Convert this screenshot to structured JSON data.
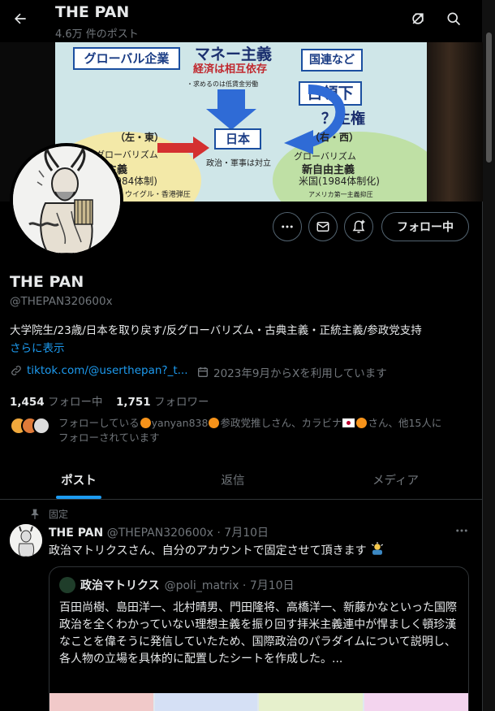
{
  "header": {
    "name": "THE PAN",
    "post_count": "4.6万 件のポスト"
  },
  "banner": {
    "global_corp": "グローバル企業",
    "money": "マネー主義",
    "money_sub": "経済は相互依存",
    "un": "国連など",
    "occupied": "占領下",
    "sovereignty": "？主権",
    "left_east": "（左・東）",
    "right_west": "（右・西）",
    "japan": "日本",
    "japan_sub": "政治・軍事は対立",
    "gp_left": "グローバリズム",
    "gp_left2": "産主義",
    "gp_left3": "共(1984体制)",
    "gp_left4": "ベット・ウイグル・香港弾圧",
    "gp_right": "グローバリズム",
    "gp_right2": "新自由主義",
    "gp_right3": "米国(1984体制化)",
    "gp_right4": "アメリカ第一主義抑圧",
    "low_wage": "・求めるのは低賃金労働"
  },
  "actions": {
    "follow_label": "フォロー中"
  },
  "profile": {
    "name": "THE PAN",
    "handle": "@THEPAN320600x",
    "bio": "大学院生/23歳/日本を取り戻す/反グローバリズム・古典主義・正統主義/参政党支持",
    "show_more": "さらに表示",
    "link": "tiktok.com/@userthepan?_t...",
    "joined": "2023年9月からXを利用しています",
    "following_count": "1,454",
    "following_label": "フォロー中",
    "followers_count": "1,751",
    "followers_label": "フォロワー",
    "followed_by_1": "フォローしている",
    "followed_by_2": "yanyan838",
    "followed_by_3": "参政党推しさん、カラビナ",
    "followed_by_4": "さん、他15人に",
    "followed_by_5": "フォローされています"
  },
  "tabs": [
    "ポスト",
    "返信",
    "メディア"
  ],
  "tweet": {
    "pinned_label": "固定",
    "author": "THE PAN",
    "handle_date": "@THEPAN320600x · 7月10日",
    "text": "政治マトリクスさん、自分のアカウントで固定させて頂きます",
    "quote": {
      "author": "政治マトリクス",
      "handle_date": "@poli_matrix · 7月10日",
      "text": "百田尚樹、島田洋一、北村晴男、門田隆将、高橋洋一、新藤かなといった国際政治を全くわかっていない理想主義を振り回す拝米主義連中が悍ましく頓珍漢なことを偉そうに発信していたため、国際政治のパラダイムについて説明し、各人物の立場を具体的に配置したシートを作成した。..."
    }
  },
  "icons": {
    "back": "back-arrow-icon",
    "grok": "grok-icon",
    "search": "search-icon",
    "more": "more-icon",
    "message": "message-icon",
    "notify": "notification-plus-icon",
    "link": "link-icon",
    "calendar": "calendar-icon",
    "pin": "pin-icon"
  },
  "colors": {
    "accent": "#1d9bf0",
    "background": "#000000",
    "muted_text": "#71767b",
    "border": "#2f3336"
  }
}
